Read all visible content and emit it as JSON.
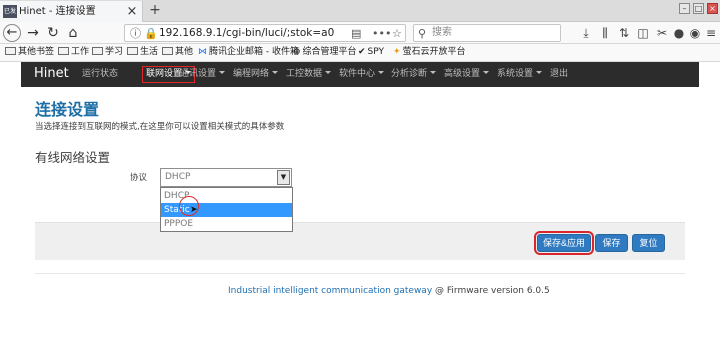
{
  "browser": {
    "tab": {
      "favicon_text": "已发送",
      "title": "Hinet - 连接设置",
      "close": "×",
      "new_tab": "+"
    },
    "url": "192.168.9.1/cgi-bin/luci/;stok=a096a...",
    "search_placeholder": "搜索",
    "bookmarks": [
      {
        "label": "其他书签"
      },
      {
        "label": "工作"
      },
      {
        "label": "学习"
      },
      {
        "label": "生活"
      },
      {
        "label": "其他"
      },
      {
        "label": "腾讯企业邮箱 - 收件箱"
      },
      {
        "label": "综合管理平台"
      },
      {
        "label": "SPY"
      },
      {
        "label": "萤石云开放平台"
      }
    ]
  },
  "router_nav": {
    "brand": "Hinet",
    "items": [
      {
        "label": "运行状态",
        "dropdown": false
      },
      {
        "label": "联网设置",
        "dropdown": true,
        "active": true
      },
      {
        "label": "通讯设置",
        "dropdown": true
      },
      {
        "label": "编程网络",
        "dropdown": true
      },
      {
        "label": "工控数据",
        "dropdown": true
      },
      {
        "label": "软件中心",
        "dropdown": true
      },
      {
        "label": "分析诊断",
        "dropdown": true
      },
      {
        "label": "高级设置",
        "dropdown": true
      },
      {
        "label": "系统设置",
        "dropdown": true
      },
      {
        "label": "退出",
        "dropdown": false
      }
    ]
  },
  "page": {
    "title": "连接设置",
    "description": "当选择连接到互联网的模式,在这里你可以设置相关模式的具体参数",
    "section_title": "有线网络设置",
    "protocol_label": "协议",
    "protocol_value": "DHCP",
    "protocol_options": [
      "DHCP",
      "Static",
      "PPPOE"
    ],
    "highlighted_option": "Static"
  },
  "buttons": {
    "save_apply": "保存&应用",
    "save": "保存",
    "reset": "复位"
  },
  "footer": {
    "link": "Industrial intelligent communication gateway",
    "text": "@ Firmware version 6.0.5"
  }
}
